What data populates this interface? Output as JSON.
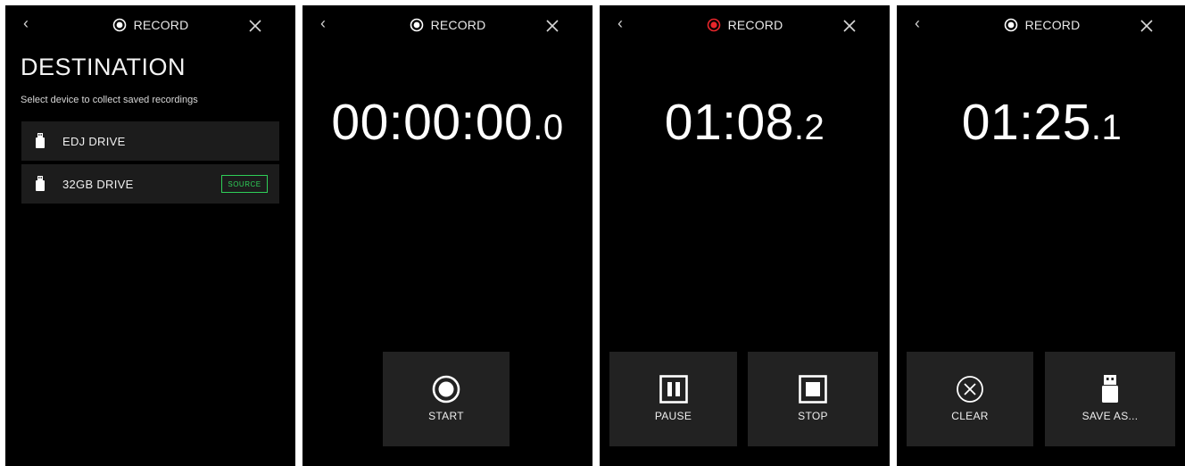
{
  "colors": {
    "background": "#000000",
    "row_bg": "#1c1c1c",
    "control_bg": "#222222",
    "source_badge": "#2fcf58",
    "record_active": "#e8262b",
    "text": "#ffffff"
  },
  "screens": [
    {
      "header": {
        "back_icon": "chevron-left-icon",
        "title": "RECORD",
        "record_active": false,
        "close_icon": "close-icon"
      },
      "heading": "DESTINATION",
      "subtitle": "Select device to collect saved recordings",
      "drives": [
        {
          "label": "EDJ DRIVE",
          "icon": "usb-drive-icon",
          "badge": ""
        },
        {
          "label": "32GB DRIVE",
          "icon": "usb-drive-icon",
          "badge": "SOURCE"
        }
      ]
    },
    {
      "header": {
        "back_icon": "chevron-left-icon",
        "title": "RECORD",
        "record_active": false,
        "close_icon": "close-icon"
      },
      "timer": {
        "main": "00:00:00",
        "fraction": ".0"
      },
      "controls": [
        {
          "label": "START",
          "icon": "record-start-icon"
        }
      ]
    },
    {
      "header": {
        "back_icon": "chevron-left-icon",
        "title": "RECORD",
        "record_active": true,
        "close_icon": "close-icon"
      },
      "timer": {
        "main": "01:08",
        "fraction": ".2"
      },
      "controls": [
        {
          "label": "PAUSE",
          "icon": "pause-icon"
        },
        {
          "label": "STOP",
          "icon": "stop-icon"
        }
      ]
    },
    {
      "header": {
        "back_icon": "chevron-left-icon",
        "title": "RECORD",
        "record_active": false,
        "close_icon": "close-icon"
      },
      "timer": {
        "main": "01:25",
        "fraction": ".1"
      },
      "controls": [
        {
          "label": "CLEAR",
          "icon": "clear-icon"
        },
        {
          "label": "SAVE AS...",
          "icon": "usb-drive-icon"
        }
      ]
    }
  ]
}
